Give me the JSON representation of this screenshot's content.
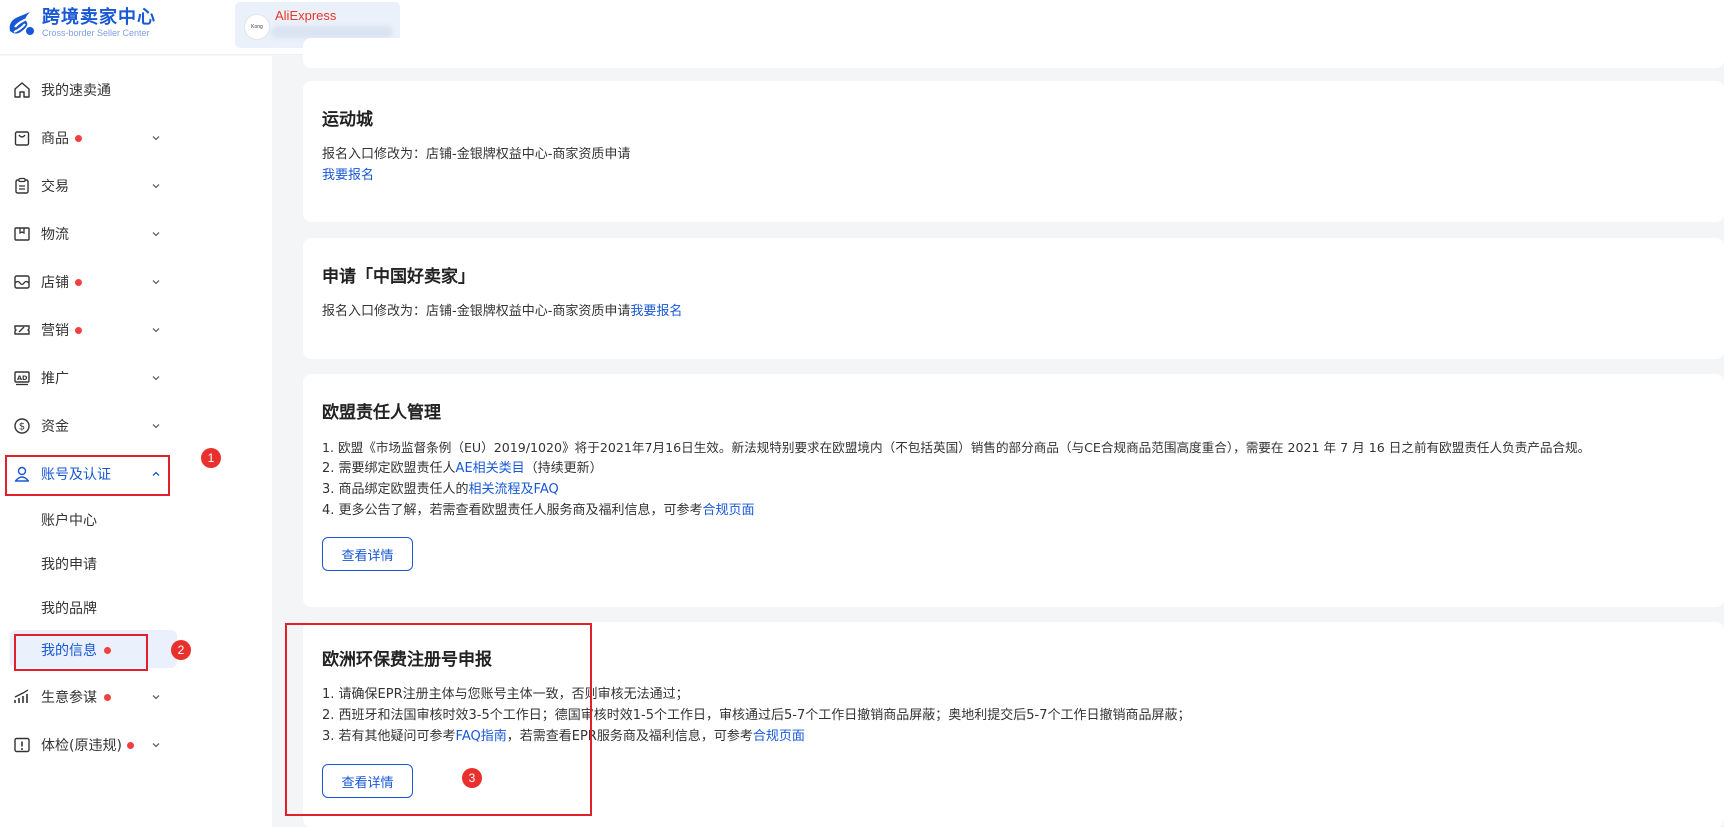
{
  "brand": {
    "title": "跨境卖家中心",
    "subtitle": "Cross-border Seller Center"
  },
  "store": {
    "platform": "AliExpress",
    "avatar_text": "Kong"
  },
  "sidebar": {
    "items": [
      {
        "label": "我的速卖通",
        "icon": "home-icon",
        "dot": false,
        "chevron": false
      },
      {
        "label": "商品",
        "icon": "shopping-bag-icon",
        "dot": true,
        "chevron": true
      },
      {
        "label": "交易",
        "icon": "clipboard-icon",
        "dot": false,
        "chevron": true
      },
      {
        "label": "物流",
        "icon": "package-icon",
        "dot": false,
        "chevron": true
      },
      {
        "label": "店铺",
        "icon": "storefront-icon",
        "dot": true,
        "chevron": true
      },
      {
        "label": "营销",
        "icon": "ticket-icon",
        "dot": true,
        "chevron": true
      },
      {
        "label": "推广",
        "icon": "ad-icon",
        "dot": false,
        "chevron": true
      },
      {
        "label": "资金",
        "icon": "dollar-icon",
        "dot": false,
        "chevron": true
      },
      {
        "label": "账号及认证",
        "icon": "user-icon",
        "dot": false,
        "chevron": true,
        "expanded": true
      },
      {
        "label": "生意参谋",
        "icon": "analytics-icon",
        "dot": true,
        "chevron": true
      },
      {
        "label": "体检(原违规)",
        "icon": "alert-icon",
        "dot": true,
        "chevron": true
      }
    ],
    "sub_items": [
      {
        "label": "账户中心"
      },
      {
        "label": "我的申请"
      },
      {
        "label": "我的品牌"
      },
      {
        "label": "我的信息",
        "dot": true,
        "selected": true
      }
    ]
  },
  "annotations": {
    "n1": "1",
    "n2": "2",
    "n3": "3"
  },
  "cards": {
    "sports": {
      "title": "运动城",
      "line1": "报名入口修改为：店铺-金银牌权益中心-商家资质申请",
      "link": "我要报名"
    },
    "good_seller": {
      "title": "申请「中国好卖家」",
      "line1_text": "报名入口修改为：店铺-金银牌权益中心-商家资质申请",
      "line1_link": "我要报名"
    },
    "eu": {
      "title": "欧盟责任人管理",
      "l1": "1. 欧盟《市场监督条例（EU）2019/1020》将于2021年7月16日生效。新法规特别要求在欧盟境内（不包括英国）销售的部分商品（与CE合规商品范围高度重合），需要在 2021 年 7 月 16 日之前有欧盟责任人负责产品合规。",
      "l2_pre": "2. 需要绑定欧盟责任人",
      "l2_link": "AE相关类目",
      "l2_post": "（持续更新）",
      "l3_pre": "3. 商品绑定欧盟责任人的",
      "l3_link": "相关流程及FAQ",
      "l4_pre": "4. 更多公告了解，若需查看欧盟责任人服务商及福利信息，可参考",
      "l4_link": "合规页面",
      "button": "查看详情"
    },
    "epr": {
      "title": "欧洲环保费注册号申报",
      "l1": "1. 请确保EPR注册主体与您账号主体一致，否则审核无法通过；",
      "l2": "2. 西班牙和法国审核时效3-5个工作日；德国审核时效1-5个工作日，审核通过后5-7个工作日撤销商品屏蔽；奥地利提交后5-7个工作日撤销商品屏蔽；",
      "l3_pre": "3. 若有其他疑问可参考",
      "l3_link1": "FAQ指南",
      "l3_mid": "，若需查看EPR服务商及福利信息，可参考",
      "l3_link2": "合规页面",
      "button": "查看详情"
    }
  },
  "colors": {
    "brand_blue": "#1858d6",
    "annotation_red": "#e0202a",
    "dot_red": "#f04040",
    "aliexpress_red": "#e8382b"
  }
}
